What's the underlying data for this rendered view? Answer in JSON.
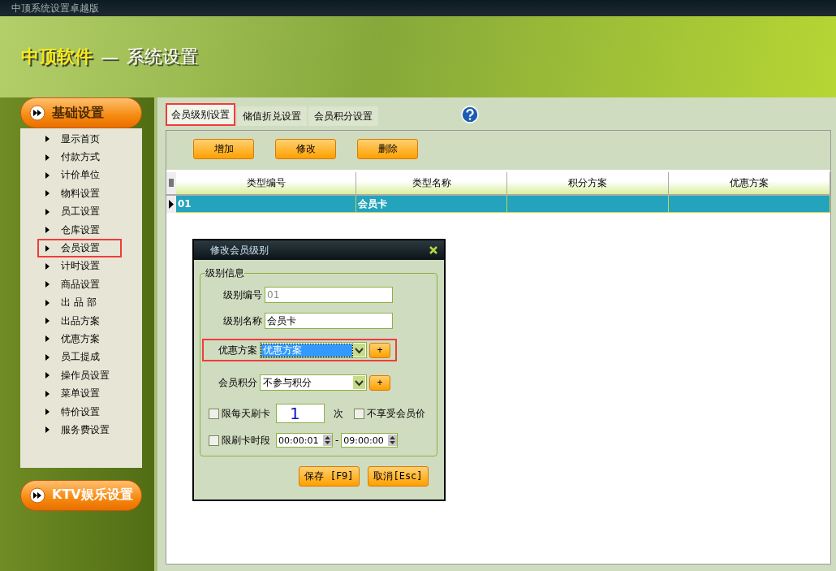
{
  "window": {
    "title": "中顶系统设置卓越版"
  },
  "header": {
    "brand": "中顶软件",
    "dash": "—",
    "subtitle": "系统设置"
  },
  "sidebar": {
    "sections": [
      {
        "label": "基础设置",
        "expanded": true,
        "items": [
          {
            "label": "显示首页",
            "highlighted": false
          },
          {
            "label": "付款方式",
            "highlighted": false
          },
          {
            "label": "计价单位",
            "highlighted": false
          },
          {
            "label": "物料设置",
            "highlighted": false
          },
          {
            "label": "员工设置",
            "highlighted": false
          },
          {
            "label": "仓库设置",
            "highlighted": false
          },
          {
            "label": "会员设置",
            "highlighted": true
          },
          {
            "label": "计时设置",
            "highlighted": false
          },
          {
            "label": "商品设置",
            "highlighted": false
          },
          {
            "label": "出 品 部",
            "highlighted": false
          },
          {
            "label": "出品方案",
            "highlighted": false
          },
          {
            "label": "优惠方案",
            "highlighted": false
          },
          {
            "label": "员工提成",
            "highlighted": false
          },
          {
            "label": "操作员设置",
            "highlighted": false
          },
          {
            "label": "菜单设置",
            "highlighted": false
          },
          {
            "label": "特价设置",
            "highlighted": false
          },
          {
            "label": "服务费设置",
            "highlighted": false
          }
        ]
      },
      {
        "label": "KTV娱乐设置",
        "expanded": false
      }
    ]
  },
  "tabs": [
    {
      "label": "会员级别设置",
      "selected": true,
      "highlighted": true
    },
    {
      "label": "储值折兑设置",
      "selected": false,
      "highlighted": false
    },
    {
      "label": "会员积分设置",
      "selected": false,
      "highlighted": false
    }
  ],
  "toolbar": [
    "增加",
    "修改",
    "删除"
  ],
  "table": {
    "columns": [
      "类型编号",
      "类型名称",
      "积分方案",
      "优惠方案"
    ],
    "rows": [
      {
        "cells": [
          "01",
          "会员卡"
        ],
        "selected": true
      }
    ]
  },
  "dialog": {
    "title": "修改会员级别",
    "group": "级别信息",
    "fields": [
      {
        "kind": "text",
        "label": "级别编号",
        "value": "01",
        "readonly": true
      },
      {
        "kind": "text",
        "label": "级别名称",
        "value": "会员卡",
        "readonly": false
      },
      {
        "kind": "select",
        "label": "优惠方案",
        "value": "优惠方案",
        "selected": true,
        "highlighted": true,
        "add": "+"
      },
      {
        "kind": "select",
        "label": "会员积分",
        "value": "不参与积分",
        "selected": false,
        "highlighted": false,
        "add": "+"
      }
    ],
    "limit_daily": {
      "label": "限每天刷卡",
      "checked": false,
      "count": "1",
      "unit": "次"
    },
    "no_member_price": {
      "label": "不享受会员价",
      "checked": false
    },
    "limit_time": {
      "label": "限刷卡时段",
      "checked": false,
      "from": "00:00:01",
      "separator": "-",
      "to": "09:00:00"
    },
    "buttons": [
      "保存 [F9]",
      "取消[Esc]"
    ]
  }
}
